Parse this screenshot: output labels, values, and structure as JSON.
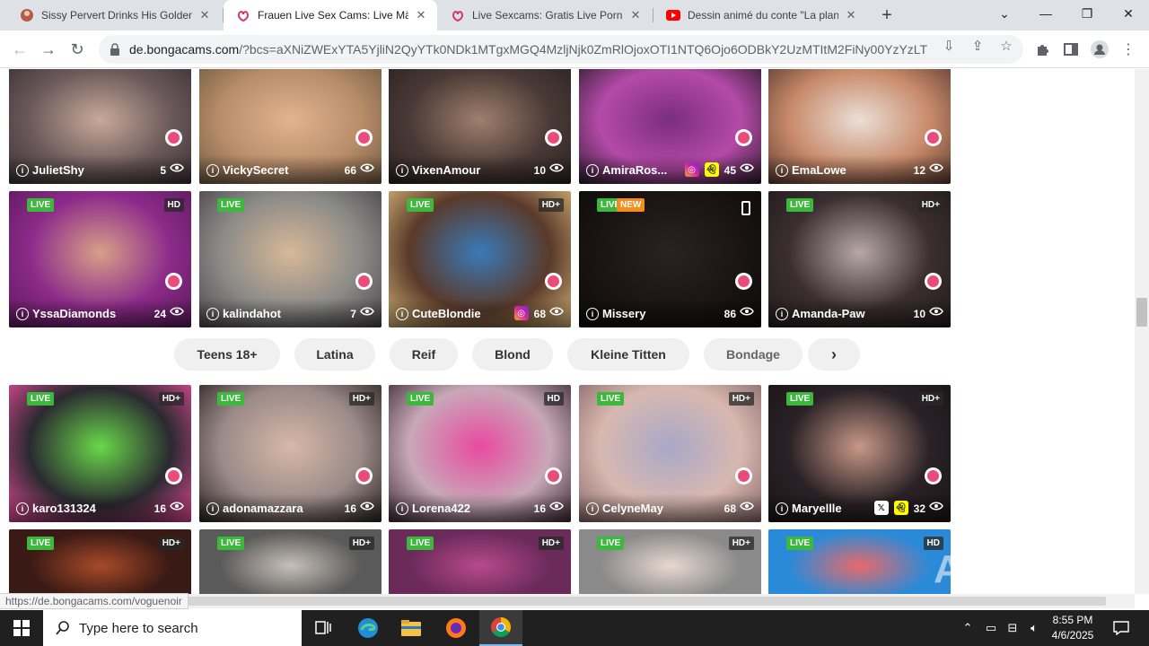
{
  "browser": {
    "tabs": [
      {
        "title": "Sissy Pervert Drinks His Golden p",
        "favicon": "site-avatar-icon",
        "active": false
      },
      {
        "title": "Frauen Live Sex Cams: Live Mäd",
        "favicon": "bongacams-icon",
        "active": true
      },
      {
        "title": "Live Sexcams: Gratis Live Porn C",
        "favicon": "bongacams-icon",
        "active": false
      },
      {
        "title": "Dessin animé du conte \"La planè",
        "favicon": "youtube-icon",
        "active": false
      }
    ],
    "url_host": "de.bongacams.com",
    "url_rest": "/?bcs=aXNiZWExYTA5YjliN2QyYTk0NDk1MTgxMGQ4MzljNjk0ZmRlOjoxOTI1NTQ6Ojo6ODBkY2UzMTItM2FiNy00YzYzLTllNjIt..."
  },
  "cams_row1": [
    {
      "name": "JulietShy",
      "viewers": "5",
      "colors": [
        "#6b5a5a",
        "#c9a99a",
        "#3a2f35"
      ]
    },
    {
      "name": "VickySecret",
      "viewers": "66",
      "colors": [
        "#b98d6a",
        "#e2b48f",
        "#6f5a3f"
      ]
    },
    {
      "name": "VixenAmour",
      "viewers": "10",
      "colors": [
        "#4a3a36",
        "#a07f6e",
        "#2a2222"
      ]
    },
    {
      "name": "AmiraRos...",
      "viewers": "45",
      "social": [
        "instagram",
        "snapchat"
      ],
      "colors": [
        "#b44aa8",
        "#7a2d7e",
        "#2b1b2b"
      ]
    },
    {
      "name": "EmaLowe",
      "viewers": "12",
      "colors": [
        "#c88a6a",
        "#eadfd7",
        "#5a3a30"
      ]
    }
  ],
  "cams_row2": [
    {
      "name": "YssaDiamonds",
      "viewers": "24",
      "live": "LIVE",
      "hd": "HD",
      "colors": [
        "#8c2a8a",
        "#d8a088",
        "#5a1a5a"
      ]
    },
    {
      "name": "kalindahot",
      "viewers": "7",
      "live": "LIVE",
      "hd": "",
      "colors": [
        "#8a8a88",
        "#d8b898",
        "#4a4448"
      ]
    },
    {
      "name": "CuteBlondie",
      "viewers": "68",
      "live": "LIVE",
      "hd": "HD+",
      "social": [
        "instagram"
      ],
      "colors": [
        "#5a3a2a",
        "#3a7ab8",
        "#d8b878"
      ]
    },
    {
      "name": "Missery",
      "viewers": "86",
      "live": "LIVE",
      "new": "NEW",
      "mobile": true,
      "colors": [
        "#1a1414",
        "#2a2220",
        "#0e0a0a"
      ]
    },
    {
      "name": "Amanda-Paw",
      "viewers": "10",
      "live": "LIVE",
      "hd": "HD+",
      "colors": [
        "#3a2e30",
        "#b8a8a8",
        "#221a1c"
      ]
    }
  ],
  "categories": [
    "Teens 18+",
    "Latina",
    "Reif",
    "Blond",
    "Kleine Titten",
    "Bondage"
  ],
  "cams_row3": [
    {
      "name": "karo131324",
      "viewers": "16",
      "live": "LIVE",
      "hd": "HD+",
      "colors": [
        "#2a2a30",
        "#6ad84a",
        "#e84a9a"
      ]
    },
    {
      "name": "adonamazzara",
      "viewers": "16",
      "live": "LIVE",
      "hd": "HD+",
      "colors": [
        "#9a8a88",
        "#d8b8a8",
        "#2a2222"
      ]
    },
    {
      "name": "Lorena422",
      "viewers": "16",
      "live": "LIVE",
      "hd": "HD",
      "colors": [
        "#c8a8b8",
        "#e84aa0",
        "#3a2a30"
      ]
    },
    {
      "name": "CelyneMay",
      "viewers": "68",
      "live": "LIVE",
      "hd": "HD+",
      "colors": [
        "#d8b8b0",
        "#a8a8c8",
        "#886868"
      ]
    },
    {
      "name": "Maryellle",
      "viewers": "32",
      "live": "LIVE",
      "hd": "HD+",
      "social": [
        "x",
        "snapchat"
      ],
      "colors": [
        "#2a2226",
        "#c89888",
        "#1a1416"
      ]
    }
  ],
  "cams_row4": [
    {
      "live": "LIVE",
      "hd": "HD+",
      "colors": [
        "#3a1a14",
        "#a84a2a"
      ]
    },
    {
      "live": "LIVE",
      "hd": "HD+",
      "colors": [
        "#5a5a5a",
        "#c8c0b8"
      ]
    },
    {
      "live": "LIVE",
      "hd": "HD+",
      "colors": [
        "#6a2a5a",
        "#b84a8a"
      ]
    },
    {
      "live": "LIVE",
      "hd": "HD+",
      "colors": [
        "#8a8a8a",
        "#e8d8d0"
      ]
    },
    {
      "live": "LIVE",
      "hd": "HD",
      "colors": [
        "#2a8ad8",
        "#e86a6a"
      ]
    }
  ],
  "status_url": "https://de.bongacams.com/voguenoir",
  "watermark": "ANY RUN",
  "taskbar": {
    "search_placeholder": "Type here to search",
    "time": "8:55 PM",
    "date": "4/6/2025"
  }
}
